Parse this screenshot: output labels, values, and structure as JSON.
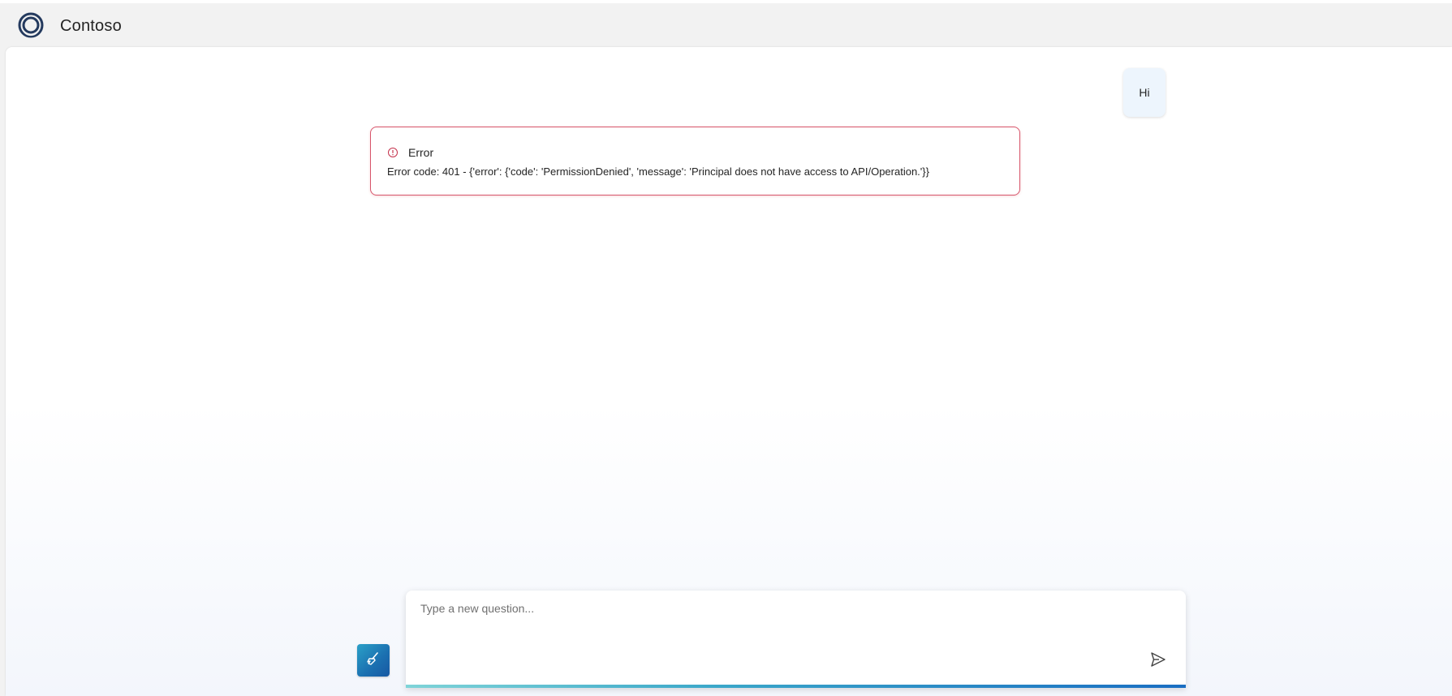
{
  "header": {
    "brand_name": "Contoso",
    "logo_icon": "contoso-ring-logo-icon"
  },
  "chat": {
    "user_message": "Hi",
    "error": {
      "icon": "error-circle-icon",
      "title": "Error",
      "message": "Error code: 401 - {'error': {'code': 'PermissionDenied', 'message': 'Principal does not have access to API/Operation.'}}"
    }
  },
  "composer": {
    "placeholder": "Type a new question...",
    "value": "",
    "clear_icon": "broom-icon",
    "send_icon": "send-icon"
  },
  "colors": {
    "accent": "#1b6fb0",
    "error_border": "#d7556b",
    "user_bubble": "#edf5fd"
  }
}
